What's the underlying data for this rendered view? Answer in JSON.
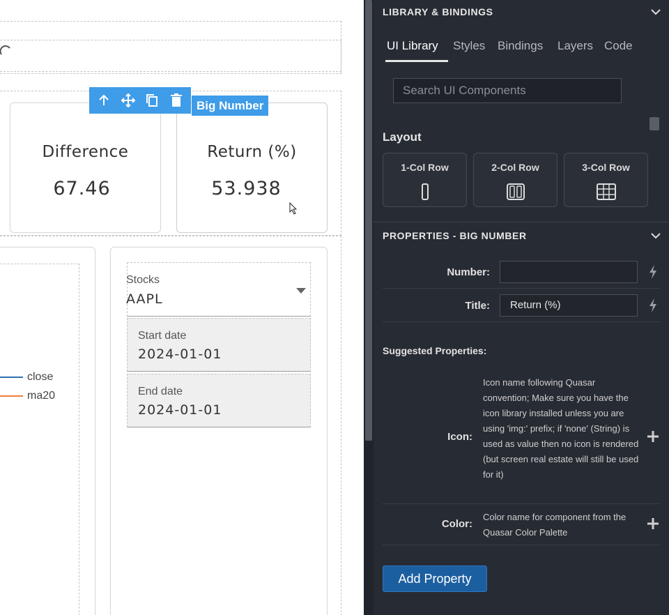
{
  "canvas": {
    "toolbar": {
      "up_icon": "arrow-up-icon",
      "move_icon": "move-icon",
      "copy_icon": "copy-icon",
      "delete_icon": "trash-icon"
    },
    "selected_tag": "Big Number",
    "big_numbers": [
      {
        "title": "Difference",
        "value": "67.46"
      },
      {
        "title": "Return (%)",
        "value": "53.938"
      }
    ],
    "legend": [
      {
        "label": "close",
        "color": "#2f6fb0"
      },
      {
        "label": "ma20",
        "color": "#ef7b3a"
      }
    ],
    "stocks_select": {
      "label": "Stocks",
      "value": "AAPL"
    },
    "start_date": {
      "label": "Start date",
      "value": "2024-01-01"
    },
    "end_date": {
      "label": "End date",
      "value": "2024-01-01"
    }
  },
  "panel": {
    "library_header": "LIBRARY & BINDINGS",
    "tabs": [
      "UI Library",
      "Styles",
      "Bindings",
      "Layers",
      "Code"
    ],
    "active_tab": "UI Library",
    "search_placeholder": "Search UI Components",
    "layout_heading": "Layout",
    "layout_items": [
      "1-Col Row",
      "2-Col Row",
      "3-Col Row"
    ],
    "properties_header": "PROPERTIES - BIG NUMBER",
    "properties": [
      {
        "label": "Number:",
        "value": ""
      },
      {
        "label": "Title:",
        "value": "Return (%)"
      }
    ],
    "suggested_heading": "Suggested Properties:",
    "suggested": [
      {
        "label": "Icon:",
        "description": "Icon name following Quasar convention; Make sure you have the icon library installed unless you are using 'img:' prefix; if 'none' (String) is used as value then no icon is rendered (but screen real estate will still be used for it)"
      },
      {
        "label": "Color:",
        "description": "Color name for component from the Quasar Color Palette"
      }
    ],
    "add_property_label": "Add Property",
    "colors": {
      "panel_bg": "#272b33",
      "accent": "#3f9ce8",
      "button": "#1c5fa0"
    }
  }
}
